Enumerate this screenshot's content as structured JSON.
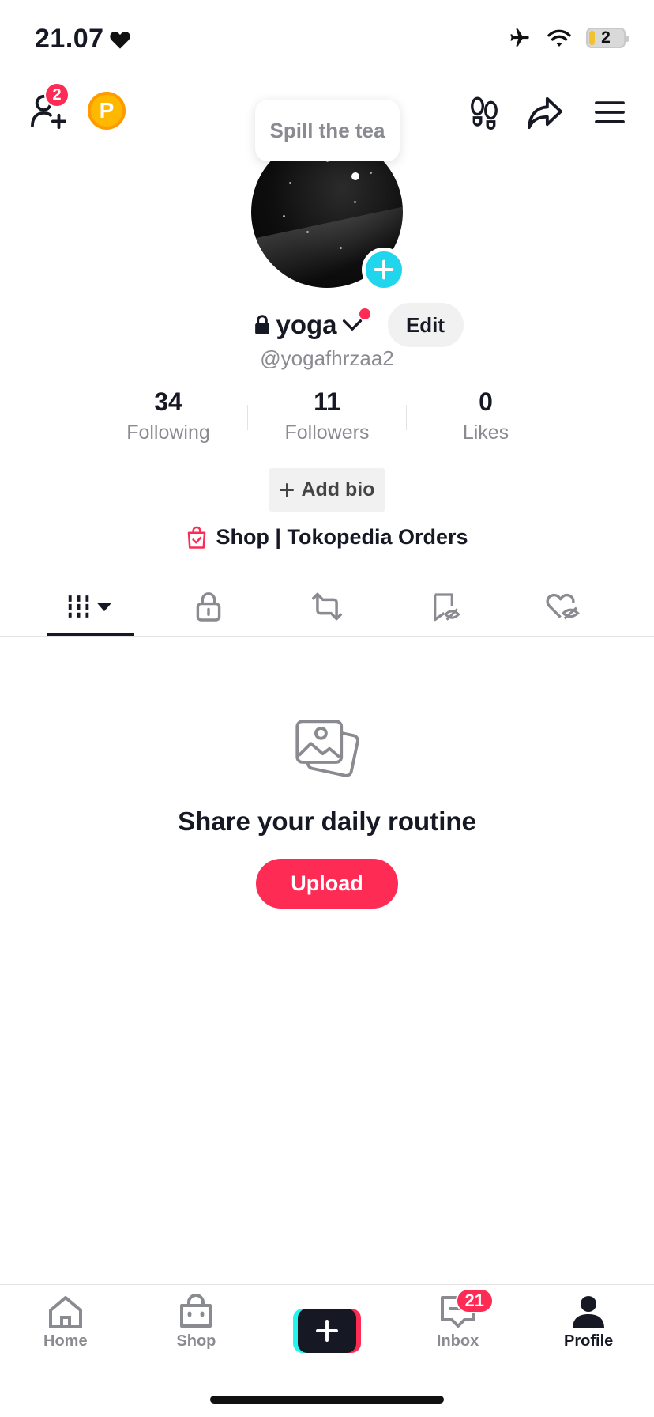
{
  "status_bar": {
    "time": "21.07",
    "battery": "2"
  },
  "header": {
    "friends_badge": "2",
    "coin_letter": "P"
  },
  "tooltip": "Spill the tea",
  "profile": {
    "username": "yoga",
    "handle": "@yogafhrzaa2",
    "edit_label": "Edit",
    "stats": [
      {
        "value": "34",
        "label": "Following"
      },
      {
        "value": "11",
        "label": "Followers"
      },
      {
        "value": "0",
        "label": "Likes"
      }
    ],
    "add_bio": "Add bio",
    "shop_link": "Shop | Tokopedia Orders"
  },
  "empty_state": {
    "title": "Share your daily routine",
    "button": "Upload"
  },
  "bottom_nav": {
    "items": [
      {
        "label": "Home"
      },
      {
        "label": "Shop"
      },
      {
        "label": ""
      },
      {
        "label": "Inbox",
        "badge": "21"
      },
      {
        "label": "Profile"
      }
    ]
  },
  "colors": {
    "accent": "#fe2c55",
    "cyan": "#20d5ec",
    "text": "#161823",
    "muted": "#8a8b91"
  },
  "icons": [
    "heart-icon",
    "airplane-icon",
    "wifi-icon",
    "add-friend-icon",
    "footprints-icon",
    "share-icon",
    "menu-icon",
    "lock-icon",
    "chevron-down-icon",
    "plus-icon",
    "shopping-bag-icon",
    "grid-icon",
    "repost-icon",
    "bookmark-hidden-icon",
    "heart-hidden-icon",
    "gallery-icon",
    "home-icon",
    "shop-icon",
    "inbox-icon",
    "profile-icon"
  ]
}
